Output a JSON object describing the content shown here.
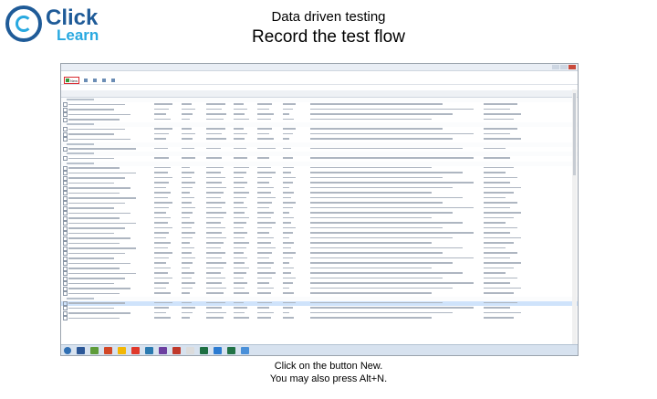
{
  "logo": {
    "word1": "Click",
    "word2": "Learn"
  },
  "slide": {
    "title": "Data driven testing",
    "subtitle": "Record the test flow",
    "caption_line1": "Click on the button New.",
    "caption_line2": "You may also press Alt+N."
  },
  "app": {
    "toolbar": {
      "new_label": "New"
    }
  },
  "taskbar": {
    "app_colors": [
      "#2b5797",
      "#5e9c3a",
      "#d24726",
      "#f2b705",
      "#e0392b",
      "#2a7ab0",
      "#6c3fa0",
      "#c0392b",
      "#dcdcdc",
      "#1d6f42",
      "#2b7bd1",
      "#217346",
      "#4a90d9"
    ]
  },
  "colors": {
    "brand_dark": "#1f5b98",
    "brand_light": "#29a9e0",
    "highlight": "#d8292f"
  }
}
